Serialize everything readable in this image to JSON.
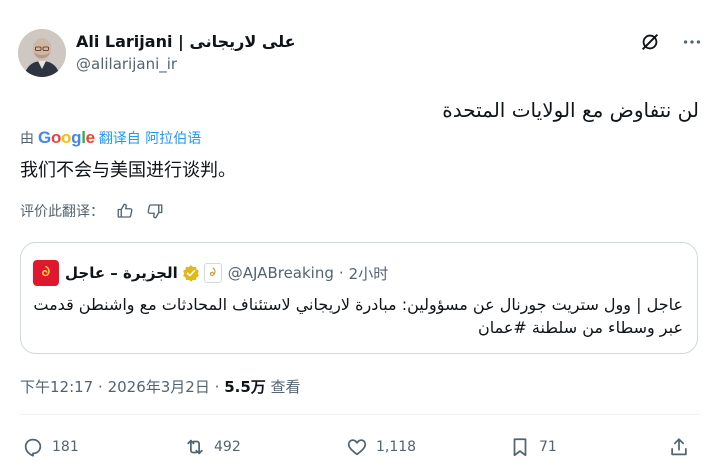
{
  "author": {
    "name": "Ali Larijani | علی لاریجانی",
    "handle": "@alilarijani_ir"
  },
  "tweet": {
    "text_original": "لن نتفاوض مع الولايات المتحدة",
    "translated_by_prefix": "由",
    "translated_by_brand": "Google",
    "translated_from": "翻译自 阿拉伯语",
    "text_translated": "我们不会与美国进行谈判。",
    "rate_translation": "评价此翻译："
  },
  "quote": {
    "name": "الجزيرة – عاجل",
    "handle": "@AJABreaking",
    "separator": "·",
    "time": "2小时",
    "text": "عاجل | وول ستريت جورنال عن مسؤولين: مبادرة لاريجاني لاستئناف المحادثات مع واشنطن قدمت عبر وسطاء من سلطنة",
    "hashtag": "#عمان"
  },
  "meta": {
    "time": "下午12:17",
    "dot1": "·",
    "date": "2026年3月2日",
    "dot2": "·",
    "views": "5.5万",
    "views_label": "查看"
  },
  "actions": {
    "replies": "181",
    "reposts": "492",
    "likes": "1,118",
    "bookmarks": "71"
  },
  "icons": [
    "grok-icon",
    "more-icon",
    "thumbs-up-icon",
    "thumbs-down-icon",
    "verified-badge-icon",
    "reply-icon",
    "repost-icon",
    "like-icon",
    "bookmark-icon",
    "share-icon"
  ],
  "colors": {
    "text": "#0f1419",
    "secondary": "#536471",
    "link": "#1d9bf0",
    "border": "#cfd9de",
    "verified_gold": "#e2b719",
    "aljazeera_red": "#e0182d"
  }
}
